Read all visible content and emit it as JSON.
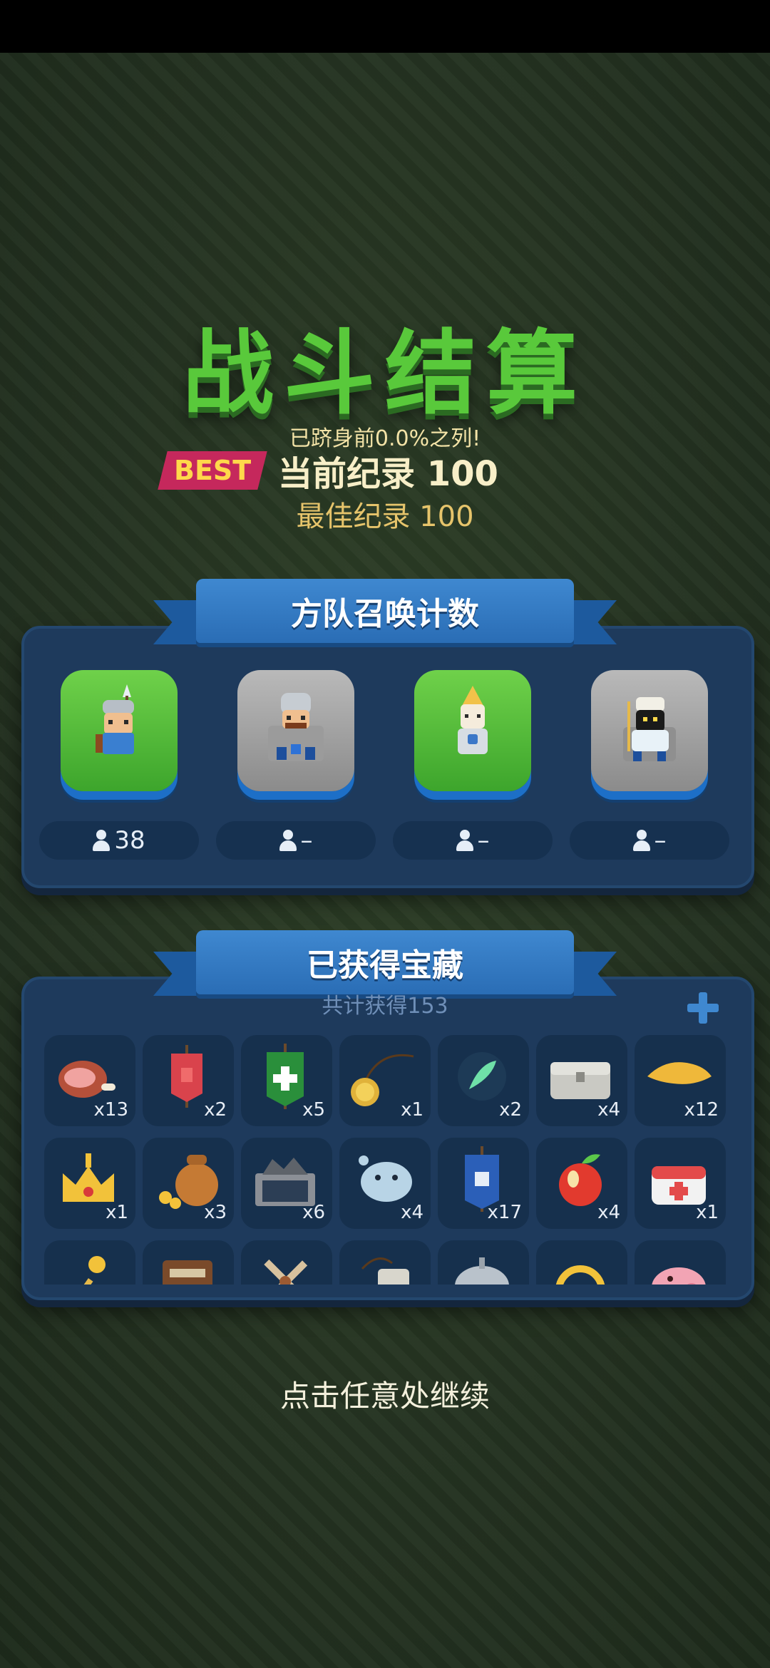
{
  "title": "战斗结算",
  "rank_text": "已跻身前0.0%之列!",
  "best_badge": "BEST",
  "current_record": "当前纪录 100",
  "best_record": "最佳纪录 100",
  "squad": {
    "title": "方队召唤计数",
    "units": [
      {
        "icon": "spearman-icon",
        "count": "38",
        "tile": "grass"
      },
      {
        "icon": "knight-castle-icon",
        "count": "–",
        "tile": "stone"
      },
      {
        "icon": "bishop-icon",
        "count": "–",
        "tile": "grass"
      },
      {
        "icon": "priest-icon",
        "count": "–",
        "tile": "stone"
      }
    ]
  },
  "treasure": {
    "title": "已获得宝藏",
    "total": "共计获得153",
    "rows": [
      [
        {
          "icon": "ham-icon",
          "qty": "x13"
        },
        {
          "icon": "red-banner-icon",
          "qty": "x2"
        },
        {
          "icon": "green-cross-banner-icon",
          "qty": "x5"
        },
        {
          "icon": "gold-medallion-icon",
          "qty": "x1"
        },
        {
          "icon": "feather-icon",
          "qty": "x2"
        },
        {
          "icon": "stone-chest-icon",
          "qty": "x4"
        },
        {
          "icon": "golden-leaf-icon",
          "qty": "x12"
        }
      ],
      [
        {
          "icon": "crown-icon",
          "qty": "x1"
        },
        {
          "icon": "coin-sack-icon",
          "qty": "x3"
        },
        {
          "icon": "ore-cart-icon",
          "qty": "x6"
        },
        {
          "icon": "water-blob-icon",
          "qty": "x4"
        },
        {
          "icon": "blue-banner-icon",
          "qty": "x17"
        },
        {
          "icon": "apple-icon",
          "qty": "x4"
        },
        {
          "icon": "medkit-icon",
          "qty": "x1"
        }
      ],
      [
        {
          "icon": "gold-scepter-icon",
          "qty": ""
        },
        {
          "icon": "book-icon",
          "qty": ""
        },
        {
          "icon": "windmill-icon",
          "qty": ""
        },
        {
          "icon": "tag-icon",
          "qty": ""
        },
        {
          "icon": "helmet-icon",
          "qty": ""
        },
        {
          "icon": "gold-ring-icon",
          "qty": ""
        },
        {
          "icon": "pig-icon",
          "qty": ""
        }
      ]
    ]
  },
  "continue_hint": "点击任意处继续",
  "colors": {
    "title_green": "#59c93b",
    "panel": "#1e3a5c",
    "ribbon": "#3f88d0",
    "best_badge": "#c5285c"
  }
}
